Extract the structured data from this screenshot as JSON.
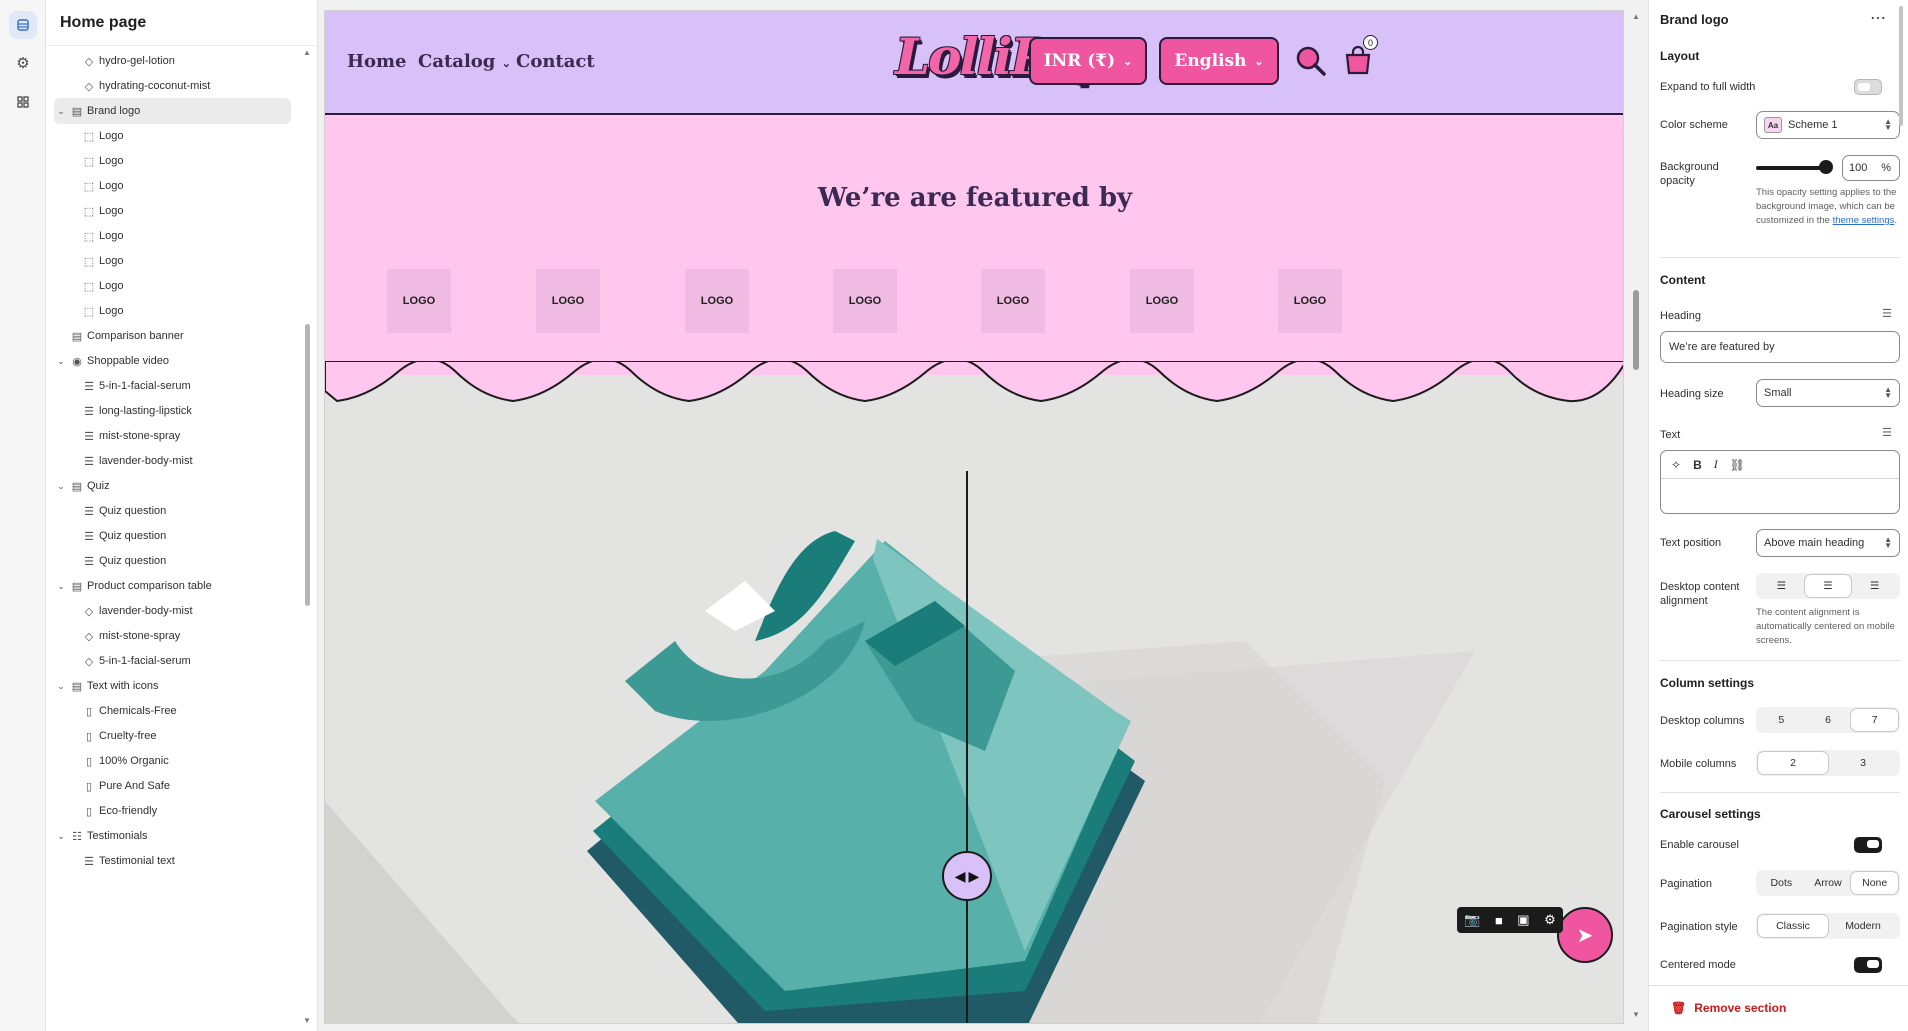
{
  "sidebar": {
    "title": "Home page",
    "items": [
      {
        "label": "hydro-gel-lotion",
        "icon": "tag-icon",
        "level": 2,
        "expanded": null
      },
      {
        "label": "hydrating-coconut-mist",
        "icon": "tag-icon",
        "level": 2,
        "expanded": null
      },
      {
        "label": "Brand logo",
        "icon": "section-icon",
        "level": 1,
        "expanded": true,
        "selected": true
      },
      {
        "label": "Logo",
        "icon": "frame-icon",
        "level": 2,
        "expanded": null
      },
      {
        "label": "Logo",
        "icon": "frame-icon",
        "level": 2,
        "expanded": null
      },
      {
        "label": "Logo",
        "icon": "frame-icon",
        "level": 2,
        "expanded": null
      },
      {
        "label": "Logo",
        "icon": "frame-icon",
        "level": 2,
        "expanded": null
      },
      {
        "label": "Logo",
        "icon": "frame-icon",
        "level": 2,
        "expanded": null
      },
      {
        "label": "Logo",
        "icon": "frame-icon",
        "level": 2,
        "expanded": null
      },
      {
        "label": "Logo",
        "icon": "frame-icon",
        "level": 2,
        "expanded": null
      },
      {
        "label": "Logo",
        "icon": "frame-icon",
        "level": 2,
        "expanded": null
      },
      {
        "label": "Comparison banner",
        "icon": "section-icon",
        "level": 1,
        "expanded": null
      },
      {
        "label": "Shoppable video",
        "icon": "play-icon",
        "level": 1,
        "expanded": true
      },
      {
        "label": "5-in-1-facial-serum",
        "icon": "lines-icon",
        "level": 2,
        "expanded": null
      },
      {
        "label": "long-lasting-lipstick",
        "icon": "lines-icon",
        "level": 2,
        "expanded": null
      },
      {
        "label": "mist-stone-spray",
        "icon": "lines-icon",
        "level": 2,
        "expanded": null
      },
      {
        "label": "lavender-body-mist",
        "icon": "lines-icon",
        "level": 2,
        "expanded": null
      },
      {
        "label": "Quiz",
        "icon": "section-icon",
        "level": 1,
        "expanded": true
      },
      {
        "label": "Quiz question",
        "icon": "lines-icon",
        "level": 2,
        "expanded": null
      },
      {
        "label": "Quiz question",
        "icon": "lines-icon",
        "level": 2,
        "expanded": null
      },
      {
        "label": "Quiz question",
        "icon": "lines-icon",
        "level": 2,
        "expanded": null
      },
      {
        "label": "Product comparison table",
        "icon": "section-icon",
        "level": 1,
        "expanded": true
      },
      {
        "label": "lavender-body-mist",
        "icon": "tag-icon",
        "level": 2,
        "expanded": null
      },
      {
        "label": "mist-stone-spray",
        "icon": "tag-icon",
        "level": 2,
        "expanded": null
      },
      {
        "label": "5-in-1-facial-serum",
        "icon": "tag-icon",
        "level": 2,
        "expanded": null
      },
      {
        "label": "Text with icons",
        "icon": "text-block-icon",
        "level": 1,
        "expanded": true
      },
      {
        "label": "Chemicals-Free",
        "icon": "column-icon",
        "level": 2,
        "expanded": null
      },
      {
        "label": "Cruelty-free",
        "icon": "column-icon",
        "level": 2,
        "expanded": null
      },
      {
        "label": "100% Organic",
        "icon": "column-icon",
        "level": 2,
        "expanded": null
      },
      {
        "label": "Pure And Safe",
        "icon": "column-icon",
        "level": 2,
        "expanded": null
      },
      {
        "label": "Eco-friendly",
        "icon": "column-icon",
        "level": 2,
        "expanded": null
      },
      {
        "label": "Testimonials",
        "icon": "quote-list-icon",
        "level": 1,
        "expanded": true
      },
      {
        "label": "Testimonial text",
        "icon": "lines-icon",
        "level": 2,
        "expanded": null
      }
    ]
  },
  "store": {
    "nav": [
      "Home",
      "Catalog",
      "Contact"
    ],
    "logo": "LolliPop",
    "currency": "INR (₹)",
    "language": "English",
    "cart_count": "0",
    "colors": {
      "header_bg": "#d8c0f8",
      "featured_bg": "#ffc6ee",
      "accent": "#f056a0",
      "ink": "#3b2a52"
    },
    "featured_heading": "We’re are featured by",
    "logo_placeholders": [
      "LOGO",
      "LOGO",
      "LOGO",
      "LOGO",
      "LOGO",
      "LOGO",
      "LOGO"
    ]
  },
  "panel": {
    "title": "Brand logo",
    "layout_title": "Layout",
    "expand_label": "Expand to full width",
    "expand_on": false,
    "color_scheme_label": "Color scheme",
    "color_scheme_badge": "Aa",
    "color_scheme_value": "Scheme 1",
    "bg_opacity_label": "Background opacity",
    "bg_opacity_value": "100",
    "bg_opacity_unit": "%",
    "opacity_help": "This opacity setting applies to the background image, which can be customized in the",
    "opacity_help_link": "theme settings",
    "content_title": "Content",
    "heading_label": "Heading",
    "heading_value": "We’re are featured by",
    "heading_size_label": "Heading size",
    "heading_size_value": "Small",
    "text_label": "Text",
    "text_position_label": "Text position",
    "text_position_value": "Above main heading",
    "desktop_align_label": "Desktop content alignment",
    "desktop_align_selected": "center",
    "align_help": "The content alignment is automatically centered on mobile screens.",
    "column_title": "Column settings",
    "desktop_columns_label": "Desktop columns",
    "desktop_columns": [
      "5",
      "6",
      "7"
    ],
    "desktop_columns_selected": "7",
    "mobile_columns_label": "Mobile columns",
    "mobile_columns": [
      "2",
      "3"
    ],
    "mobile_columns_selected": "2",
    "carousel_title": "Carousel settings",
    "enable_carousel_label": "Enable carousel",
    "enable_carousel_on": true,
    "pagination_label": "Pagination",
    "pagination_options": [
      "Dots",
      "Arrow",
      "None"
    ],
    "pagination_selected": "None",
    "pagination_style_label": "Pagination style",
    "pagination_style_options": [
      "Classic",
      "Modern"
    ],
    "pagination_style_selected": "Classic",
    "centered_mode_label": "Centered mode",
    "centered_mode_on": true,
    "remove_label": "Remove section"
  }
}
